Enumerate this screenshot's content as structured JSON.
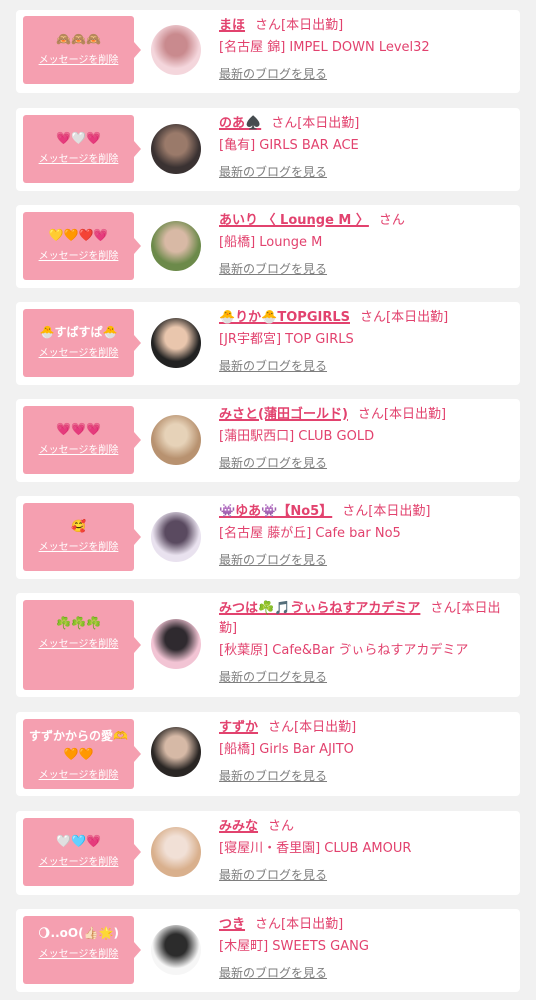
{
  "delete_label": "メッセージを削除",
  "blog_label": "最新のブログを見る",
  "san_label": "さん",
  "colors": {
    "accent": "#e2426e",
    "bubble": "#f59fb0",
    "background": "#f1f1f1",
    "card": "#ffffff",
    "link_gray": "#7e7e7e"
  },
  "entries": [
    {
      "message": "🙈🙈🙈",
      "name": "まほ",
      "status": "[本日出勤]",
      "shop": "[名古屋 錦] IMPEL DOWN Level32",
      "avatar": [
        "#f4d6dc",
        "#c98a8e"
      ]
    },
    {
      "message": "💗🤍💗",
      "name": "のあ♠️",
      "status": "[本日出勤]",
      "shop": "[亀有] GIRLS BAR ACE",
      "avatar": [
        "#3a3232",
        "#9a7a6a"
      ]
    },
    {
      "message": "💛🧡❤️💗",
      "name": "あいり 〈 Lounge M 〉",
      "status": "",
      "shop": "[船橋] Lounge M",
      "avatar": [
        "#6c8a4a",
        "#d8b9a5"
      ]
    },
    {
      "message": "🐣すぱすぱ🐣",
      "name": "🐣りか🐣TOPGIRLS",
      "status": "[本日出勤]",
      "shop": "[JR宇都宮] TOP GIRLS",
      "avatar": [
        "#222222",
        "#e9c6ad"
      ]
    },
    {
      "message": "💗💗💗",
      "name": "みさと(蒲田ゴールド)",
      "status": "[本日出勤]",
      "shop": "[蒲田駅西口] CLUB GOLD",
      "avatar": [
        "#b89270",
        "#e6d2b8"
      ]
    },
    {
      "message": "🥰",
      "name": "👾ゆあ👾【No5】",
      "status": "[本日出勤]",
      "shop": "[名古屋 藤が丘] Cafe bar No5",
      "avatar": [
        "#e9e2ef",
        "#5a4a60"
      ]
    },
    {
      "message": "☘️☘️☘️",
      "name": "みつは☘️🎵ゔぃらねすアカデミア",
      "status": "[本日出勤]",
      "shop": "[秋葉原] Cafe&Bar ゔぃらねすアカデミア",
      "avatar": [
        "#f2c4d4",
        "#2f2a2f"
      ]
    },
    {
      "message": "すずかからの愛🫶 🧡🧡",
      "name": "すずか",
      "status": "[本日出勤]",
      "shop": "[船橋] Girls Bar AJITO",
      "avatar": [
        "#2a2624",
        "#d6b9a6"
      ]
    },
    {
      "message": "🤍🩵💗",
      "name": "みみな",
      "status": "",
      "shop": "[寝屋川・香里園] CLUB AMOUR",
      "avatar": [
        "#d9b08d",
        "#f1e0d6"
      ]
    },
    {
      "message": "🌖..oO(👍🏻🌟)",
      "name": "つき",
      "status": "[本日出勤]",
      "shop": "[木屋町] SWEETS GANG",
      "avatar": [
        "#f6f6f6",
        "#2c2c2c"
      ]
    }
  ]
}
